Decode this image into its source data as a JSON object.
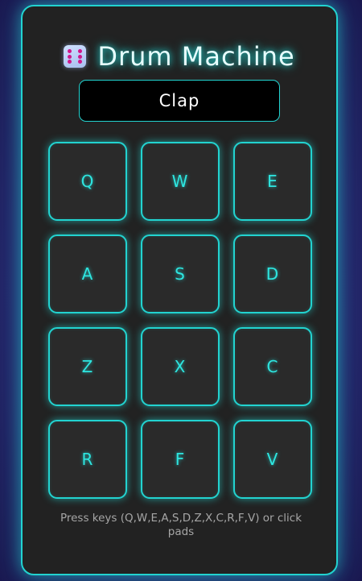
{
  "app": {
    "title": "Drum Machine",
    "icon": "dice-icon"
  },
  "display": {
    "current_sound": "Clap"
  },
  "pads": [
    {
      "key": "Q"
    },
    {
      "key": "W"
    },
    {
      "key": "E"
    },
    {
      "key": "A"
    },
    {
      "key": "S"
    },
    {
      "key": "D"
    },
    {
      "key": "Z"
    },
    {
      "key": "X"
    },
    {
      "key": "C"
    },
    {
      "key": "R"
    },
    {
      "key": "F"
    },
    {
      "key": "V"
    }
  ],
  "hint": "Press keys (Q,W,E,A,S,D,Z,X,C,R,F,V) or click pads",
  "colors": {
    "accent": "#22d3d0",
    "panel": "#222222",
    "pad": "#2a2a2a",
    "background": "#2a2a78"
  }
}
